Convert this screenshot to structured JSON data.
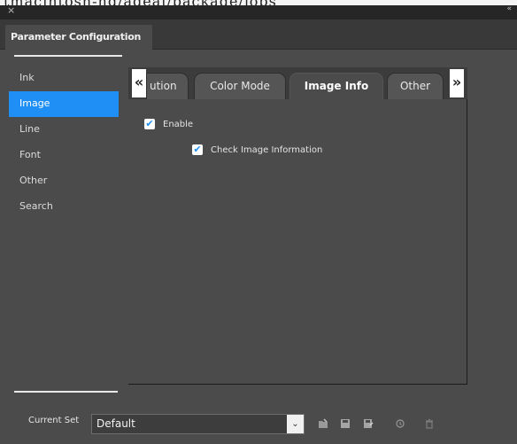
{
  "top_strip_text": "tmacintosh-hd/adeal/package/jobs",
  "window": {
    "close_glyph": "×",
    "collapse_glyph": "«",
    "panel_tab": "Parameter Configuration"
  },
  "sidebar": {
    "items": [
      {
        "label": "Ink",
        "active": false
      },
      {
        "label": "Image",
        "active": true
      },
      {
        "label": "Line",
        "active": false
      },
      {
        "label": "Font",
        "active": false
      },
      {
        "label": "Other",
        "active": false
      },
      {
        "label": "Search",
        "active": false
      }
    ]
  },
  "tabs": {
    "scroll_left": "«",
    "scroll_right": "»",
    "items": [
      {
        "label": "ution"
      },
      {
        "label": "Color Mode"
      },
      {
        "label": "Image Info",
        "active": true
      },
      {
        "label": "Other"
      }
    ]
  },
  "options": {
    "enable": {
      "label": "Enable",
      "checked": true
    },
    "check_image": {
      "label": "Check Image Information",
      "checked": true
    },
    "check_glyph": "✔"
  },
  "footer": {
    "current_set_label": "Current Set",
    "current_set_value": "Default",
    "dropdown_arrow": "⌄",
    "icons": [
      "open-icon",
      "save-icon",
      "save-as-icon",
      "reset-icon",
      "delete-icon"
    ]
  },
  "colors": {
    "accent": "#1f8ff5",
    "panel": "#4b4b4b",
    "titlebar": "#262626"
  }
}
